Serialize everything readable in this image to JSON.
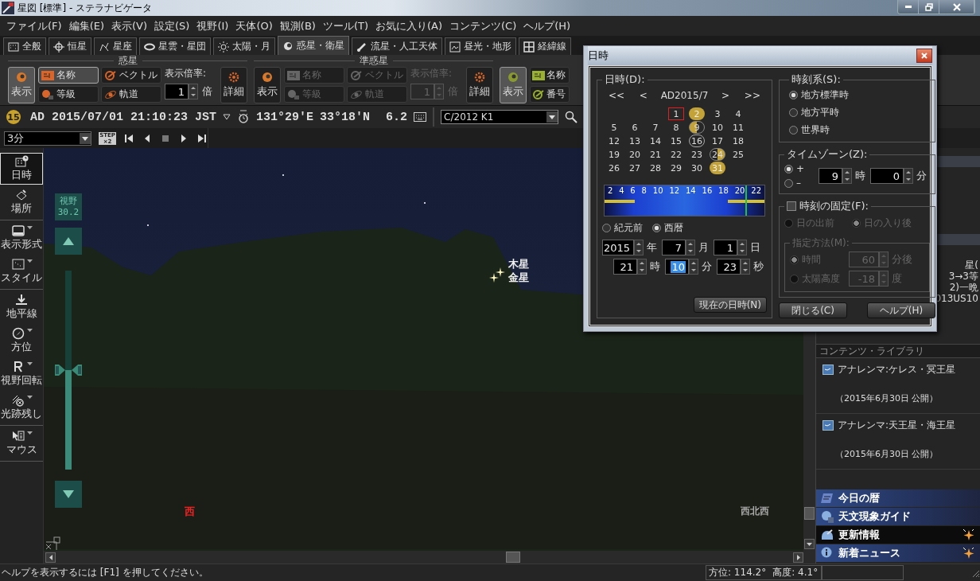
{
  "window": {
    "title": "星図 [標準] - ステラナビゲータ"
  },
  "menu": [
    "ファイル(F)",
    "編集(E)",
    "表示(V)",
    "設定(S)",
    "視野(I)",
    "天体(O)",
    "観測(B)",
    "ツール(T)",
    "お気に入り(A)",
    "コンテンツ(C)",
    "ヘルプ(H)"
  ],
  "tabs": [
    {
      "label": "全般",
      "selected": false
    },
    {
      "label": "恒星",
      "selected": false
    },
    {
      "label": "星座",
      "selected": false
    },
    {
      "label": "星雲・星団",
      "selected": false
    },
    {
      "label": "太陽・月",
      "selected": false
    },
    {
      "label": "惑星・衛星",
      "selected": true
    },
    {
      "label": "流星・人工天体",
      "selected": false
    },
    {
      "label": "昼光・地形",
      "selected": false
    },
    {
      "label": "経緯線",
      "selected": false
    }
  ],
  "ribbon": [
    {
      "title": "惑星",
      "enabled": true,
      "show": {
        "label": "表示",
        "on": true
      },
      "toggles": [
        {
          "label": "名称",
          "on": true
        },
        {
          "label": "ベクトル",
          "on": false
        },
        {
          "label": "等級",
          "on": false
        },
        {
          "label": "軌道",
          "on": false
        }
      ],
      "scale": {
        "label": "表示倍率:",
        "value": "1",
        "unit": "倍"
      },
      "detail": "詳細"
    },
    {
      "title": "準惑星",
      "enabled": false,
      "show": {
        "label": "表示",
        "on": false
      },
      "toggles": [
        {
          "label": "名称",
          "on": false
        },
        {
          "label": "ベクトル",
          "on": false
        },
        {
          "label": "等級",
          "on": false
        },
        {
          "label": "軌道",
          "on": false
        }
      ],
      "scale": {
        "label": "表示倍率:",
        "value": "1",
        "unit": "倍"
      },
      "detail": "詳細"
    },
    {
      "enabled": true,
      "show": {
        "label": "表示",
        "on": true
      },
      "toggles": [
        {
          "label": "名称",
          "on": false
        },
        {
          "label": "番号",
          "on": false
        }
      ]
    }
  ],
  "info_bar": {
    "moon_age": "15",
    "datetime": "AD 2015/07/01 21:10:23 JST",
    "longitude": "131°29'E",
    "latitude": "33°18'N",
    "fov": "6.2",
    "object": "C/2012 K1"
  },
  "step_bar": {
    "step": "3分",
    "step_button": [
      "STEP",
      "×2"
    ]
  },
  "sidebar": [
    [
      {
        "label": "日時",
        "selected": true,
        "has_menu": false
      },
      {
        "label": "場所",
        "selected": false,
        "has_menu": false
      }
    ],
    [
      {
        "label": "表示形式",
        "selected": false,
        "has_menu": true
      },
      {
        "label": "スタイル",
        "selected": false,
        "has_menu": true
      }
    ],
    [
      {
        "label": "地平線",
        "selected": false,
        "has_menu": false
      },
      {
        "label": "方位",
        "selected": false,
        "has_menu": true
      },
      {
        "label": "視野回転",
        "selected": false,
        "has_menu": true
      },
      {
        "label": "光跡残し",
        "selected": false,
        "has_menu": true
      }
    ],
    [
      {
        "label": "マウス",
        "selected": false,
        "has_menu": true
      }
    ]
  ],
  "sky": {
    "fov_label": "視野",
    "fov_value": "30.2",
    "zoom": {
      "level": 0.5
    },
    "objects": [
      {
        "label": "木星"
      },
      {
        "label": "金星"
      }
    ],
    "marker": "西",
    "direction": "西北西"
  },
  "right_panel": {
    "news_fragments": [
      "星(",
      "3→3等",
      "2)一晩",
      "013US10"
    ],
    "library_title": "コンテンツ・ライブラリ",
    "library": [
      {
        "title": "アナレンマ:ケレス・冥王星",
        "date": "（2015年6月30日 公開）"
      },
      {
        "title": "アナレンマ:天王星・海王星",
        "date": "（2015年6月30日 公開）"
      }
    ],
    "links": [
      {
        "label": "今日の暦",
        "selected": false,
        "new": false
      },
      {
        "label": "天文現象ガイド",
        "selected": false,
        "new": false
      },
      {
        "label": "更新情報",
        "selected": true,
        "new": true
      },
      {
        "label": "新着ニュース",
        "selected": false,
        "new": true
      }
    ]
  },
  "status_bar": {
    "help": "ヘルプを表示するには [F1] を押してください。",
    "azimuth": "方位: 114.2°",
    "altitude": "高度:  4.1°"
  },
  "dialog": {
    "title": "日時",
    "date_group": {
      "title": "日時(D):",
      "nav": [
        "<<",
        "<",
        ">",
        ">>"
      ],
      "month": "AD2015/7",
      "weeks": [
        [
          {
            "kind": "empty"
          },
          {
            "kind": "empty"
          },
          {
            "kind": "empty"
          },
          {
            "kind": "day",
            "day": "1",
            "selected": true
          },
          {
            "kind": "full",
            "day": "2",
            "selected": false
          },
          {
            "kind": "day",
            "day": "3",
            "selected": false
          },
          {
            "kind": "day",
            "day": "4",
            "selected": false
          }
        ],
        [
          {
            "kind": "day",
            "day": "5",
            "selected": false
          },
          {
            "kind": "day",
            "day": "6",
            "selected": false
          },
          {
            "kind": "day",
            "day": "7",
            "selected": false
          },
          {
            "kind": "day",
            "day": "8",
            "selected": false
          },
          {
            "kind": "lastquarter",
            "day": "9",
            "selected": false
          },
          {
            "kind": "day",
            "day": "10",
            "selected": false
          },
          {
            "kind": "day",
            "day": "11",
            "selected": false
          }
        ],
        [
          {
            "kind": "day",
            "day": "12",
            "selected": false
          },
          {
            "kind": "day",
            "day": "13",
            "selected": false
          },
          {
            "kind": "day",
            "day": "14",
            "selected": false
          },
          {
            "kind": "day",
            "day": "15",
            "selected": false
          },
          {
            "kind": "new",
            "day": "16",
            "selected": false
          },
          {
            "kind": "day",
            "day": "17",
            "selected": false
          },
          {
            "kind": "day",
            "day": "18",
            "selected": false
          }
        ],
        [
          {
            "kind": "day",
            "day": "19",
            "selected": false
          },
          {
            "kind": "day",
            "day": "20",
            "selected": false
          },
          {
            "kind": "day",
            "day": "21",
            "selected": false
          },
          {
            "kind": "day",
            "day": "22",
            "selected": false
          },
          {
            "kind": "day",
            "day": "23",
            "selected": false
          },
          {
            "kind": "firstquarter",
            "day": "24",
            "selected": false
          },
          {
            "kind": "day",
            "day": "25",
            "selected": false
          }
        ],
        [
          {
            "kind": "day",
            "day": "26",
            "selected": false
          },
          {
            "kind": "day",
            "day": "27",
            "selected": false
          },
          {
            "kind": "day",
            "day": "28",
            "selected": false
          },
          {
            "kind": "day",
            "day": "29",
            "selected": false
          },
          {
            "kind": "day",
            "day": "30",
            "selected": false
          },
          {
            "kind": "full",
            "day": "31",
            "selected": false
          },
          {
            "kind": "empty"
          }
        ]
      ],
      "timeline": {
        "hours": [
          "2",
          "4",
          "6",
          "8",
          "10",
          "12",
          "14",
          "16",
          "18",
          "20",
          "22"
        ],
        "level": 0.88
      },
      "era": [
        {
          "label": "紀元前",
          "selected": false
        },
        {
          "label": "西暦",
          "selected": true
        }
      ],
      "date_fields": [
        {
          "value": "2015",
          "unit": "年",
          "selected": false
        },
        {
          "value": "7",
          "unit": "月",
          "selected": false
        },
        {
          "value": "1",
          "unit": "日",
          "selected": false
        }
      ],
      "time_fields": [
        {
          "value": "21",
          "unit": "時",
          "selected": false
        },
        {
          "value": "10",
          "unit": "分",
          "selected": true
        },
        {
          "value": "23",
          "unit": "秒",
          "selected": false
        }
      ],
      "now_button": "現在の日時(N)"
    },
    "time_system": {
      "title": "時刻系(S):",
      "options": [
        {
          "label": "地方標準時",
          "selected": true
        },
        {
          "label": "地方平時",
          "selected": false
        },
        {
          "label": "世界時",
          "selected": false
        }
      ]
    },
    "timezone": {
      "title": "タイムゾーン(Z):",
      "signs": [
        {
          "label": "+",
          "selected": true
        },
        {
          "label": "–",
          "selected": false
        }
      ],
      "hours": "9",
      "hours_unit": "時",
      "minutes": "0",
      "minutes_unit": "分"
    },
    "fix_time": {
      "label": "時刻の固定(F):",
      "checked": false,
      "options": [
        {
          "label": "日の出前",
          "selected": false
        },
        {
          "label": "日の入り後",
          "selected": true
        }
      ],
      "method_title": "指定方法(M):",
      "methods": [
        {
          "label": "時間",
          "selected": true,
          "value": "60",
          "unit": "分後"
        },
        {
          "label": "太陽高度",
          "selected": false,
          "value": "-18",
          "unit": "度"
        }
      ]
    },
    "buttons": [
      "閉じる(C)",
      "ヘルプ(H)"
    ]
  }
}
